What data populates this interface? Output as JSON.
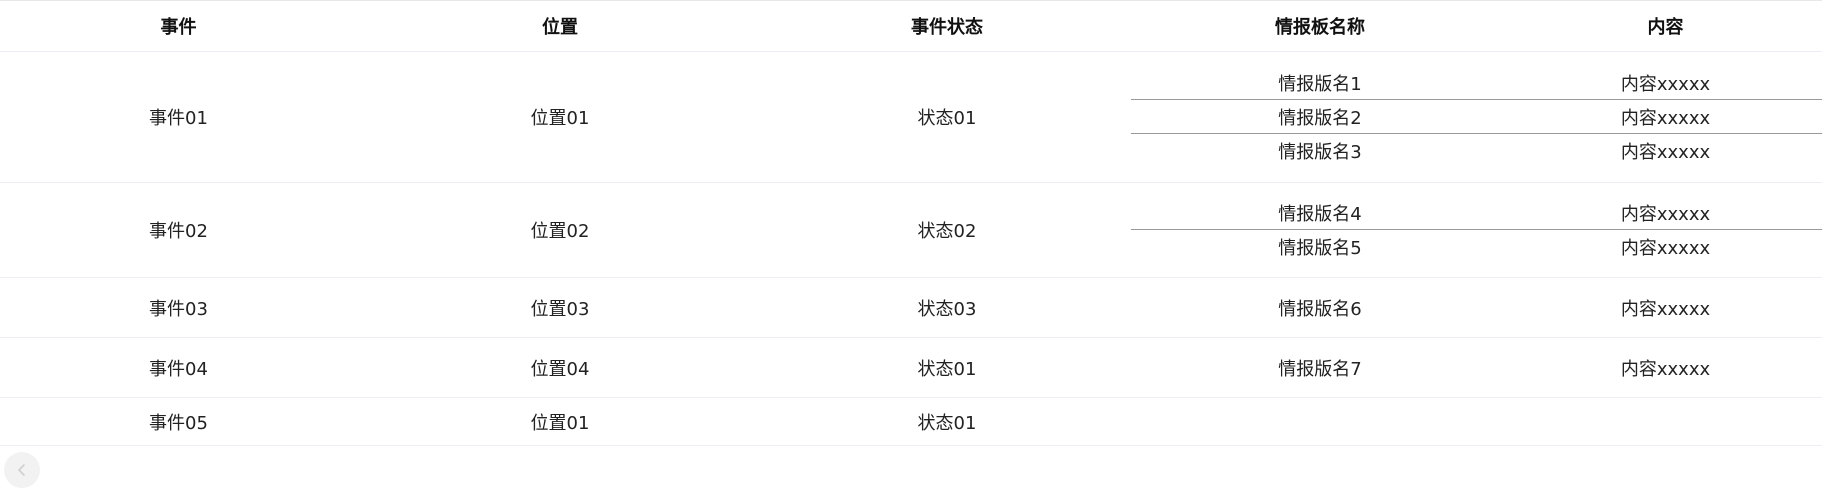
{
  "table": {
    "headers": {
      "event": "事件",
      "position": "位置",
      "status": "事件状态",
      "board_name": "情报板名称",
      "content": "内容"
    },
    "rows": [
      {
        "event": "事件01",
        "position": "位置01",
        "status": "状态01",
        "boards": [
          {
            "name": "情报版名1",
            "content": "内容xxxxx"
          },
          {
            "name": "情报版名2",
            "content": "内容xxxxx"
          },
          {
            "name": "情报版名3",
            "content": "内容xxxxx"
          }
        ]
      },
      {
        "event": "事件02",
        "position": "位置02",
        "status": "状态02",
        "boards": [
          {
            "name": "情报版名4",
            "content": "内容xxxxx"
          },
          {
            "name": "情报版名5",
            "content": "内容xxxxx"
          }
        ]
      },
      {
        "event": "事件03",
        "position": "位置03",
        "status": "状态03",
        "boards": [
          {
            "name": "情报版名6",
            "content": "内容xxxxx"
          }
        ]
      },
      {
        "event": "事件04",
        "position": "位置04",
        "status": "状态01",
        "boards": [
          {
            "name": "情报版名7",
            "content": "内容xxxxx"
          }
        ]
      },
      {
        "event": "事件05",
        "position": "位置01",
        "status": "状态01",
        "boards": []
      }
    ]
  },
  "pager": {
    "prev_icon": "chevron-left-icon",
    "prev_glyph": "‹"
  }
}
